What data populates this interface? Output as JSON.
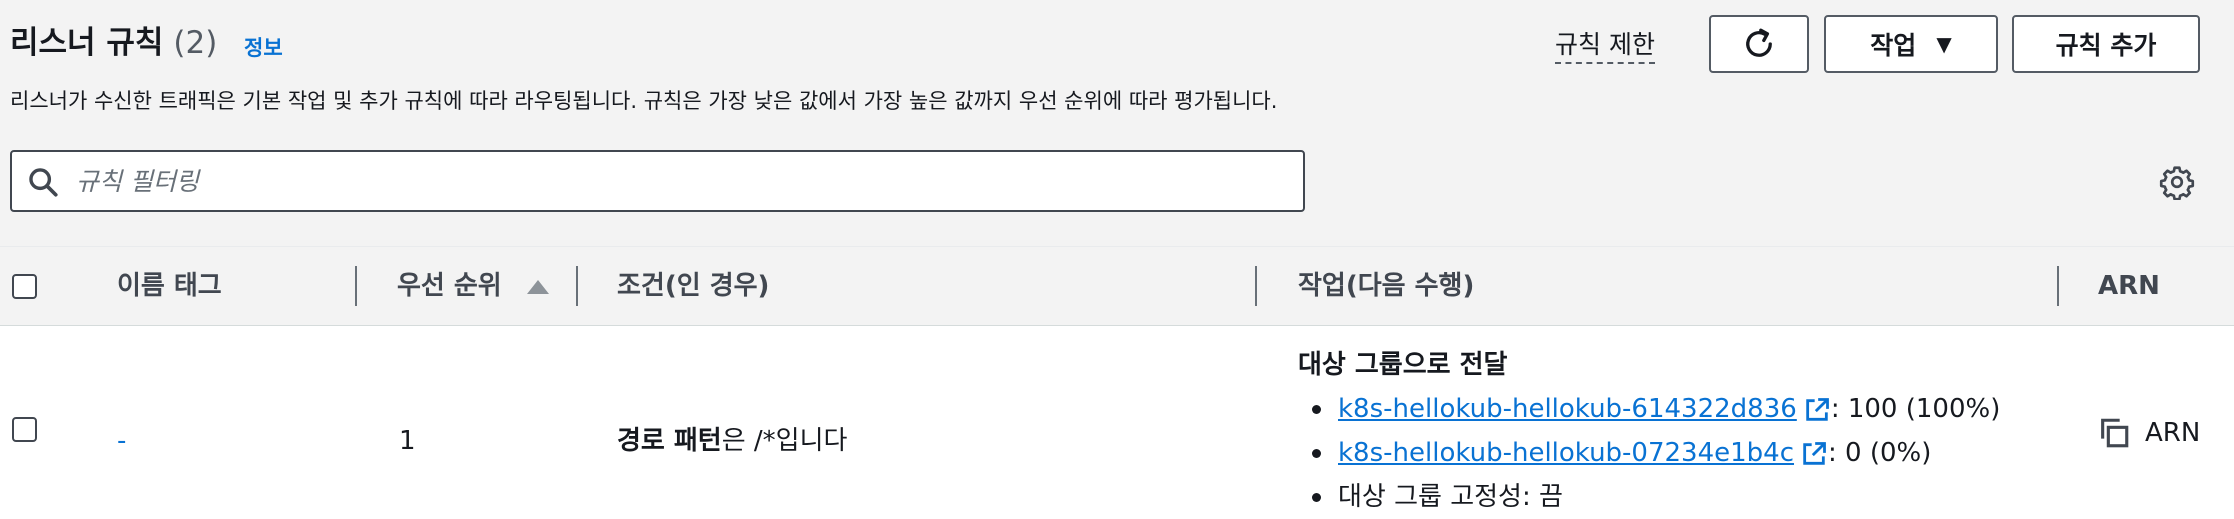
{
  "header": {
    "title": "리스너 규칙",
    "count": "(2)",
    "info_link": "정보",
    "description": "리스너가 수신한 트래픽은 기본 작업 및 추가 규칙에 따라 라우팅됩니다. 규칙은 가장 낮은 값에서 가장 높은 값까지 우선 순위에 따라 평가됩니다.",
    "rule_limit": "규칙 제한",
    "actions_button": "작업",
    "add_rule_button": "규칙 추가"
  },
  "search": {
    "placeholder": "규칙 필터링"
  },
  "table": {
    "columns": [
      "이름 태그",
      "우선 순위",
      "조건(인 경우)",
      "작업(다음 수행)",
      "ARN"
    ],
    "sorted_column": "우선 순위",
    "sort_direction": "ascending",
    "rows": [
      {
        "name_tag": "-",
        "priority": "1",
        "condition_bold": "경로 패턴",
        "condition_rest": "은 /*입니다",
        "action_title": "대상 그룹으로 전달",
        "targets": [
          {
            "name": "k8s-hellokub-hellokub-614322d836",
            "weight": ": 100 (100%)"
          },
          {
            "name": "k8s-hellokub-hellokub-07234e1b4c",
            "weight": ": 0 (0%)"
          }
        ],
        "stickiness": "대상 그룹 고정성: 끔",
        "arn_label": "ARN"
      }
    ]
  },
  "colors": {
    "link": "#0972d3",
    "header_bg": "#f3f3f3",
    "text": "#16191f"
  },
  "icons": {
    "refresh": "refresh-icon",
    "caret": "caret-down-icon",
    "search": "search-icon",
    "settings": "gear-icon",
    "external": "external-link-icon",
    "copy": "copy-icon"
  }
}
